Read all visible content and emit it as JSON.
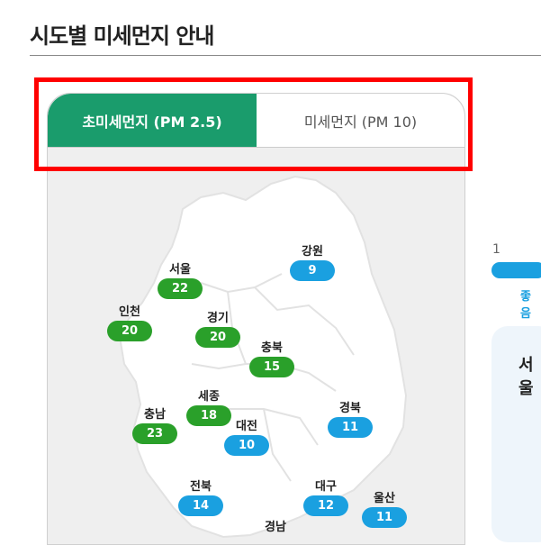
{
  "page": {
    "title": "시도별 미세먼지 안내"
  },
  "tabs": [
    {
      "label": "초미세먼지 (PM 2.5)",
      "active": true
    },
    {
      "label": "미세먼지 (PM 10)",
      "active": false
    }
  ],
  "colors": {
    "accent": "#1a9c6c",
    "good_blue": "#1aa0e0",
    "normal_green": "#2aa02a",
    "highlight": "#ff0000"
  },
  "map": {
    "regions": [
      {
        "name": "서울",
        "value": "22",
        "level": "green"
      },
      {
        "name": "인천",
        "value": "20",
        "level": "green"
      },
      {
        "name": "경기",
        "value": "20",
        "level": "green"
      },
      {
        "name": "강원",
        "value": "9",
        "level": "blue"
      },
      {
        "name": "충북",
        "value": "15",
        "level": "green"
      },
      {
        "name": "충남",
        "value": "23",
        "level": "green"
      },
      {
        "name": "세종",
        "value": "18",
        "level": "green"
      },
      {
        "name": "대전",
        "value": "10",
        "level": "blue"
      },
      {
        "name": "경북",
        "value": "11",
        "level": "blue"
      },
      {
        "name": "전북",
        "value": "14",
        "level": "blue"
      },
      {
        "name": "대구",
        "value": "12",
        "level": "blue"
      },
      {
        "name": "울산",
        "value": "11",
        "level": "blue"
      },
      {
        "name": "경남",
        "value": "",
        "level": "blue"
      }
    ]
  },
  "legend": {
    "min_label": "1",
    "good_label": "좋음"
  },
  "side": {
    "title": "서울"
  }
}
